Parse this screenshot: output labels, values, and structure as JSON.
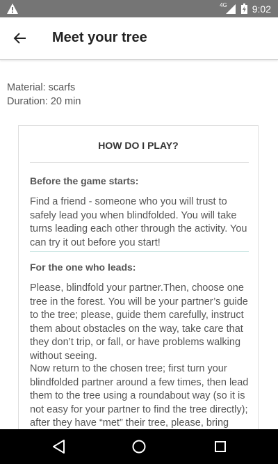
{
  "status_bar": {
    "network": "4G",
    "time": "9:02",
    "icons": [
      "warning-icon",
      "signal-icon",
      "battery-icon"
    ]
  },
  "app_bar": {
    "title": "Meet your tree",
    "back_icon": "arrow-left-icon"
  },
  "meta": {
    "material": "Material: scarfs",
    "duration": "Duration: 20 min"
  },
  "card": {
    "title": "HOW DO I PLAY?",
    "sections": [
      {
        "heading": "Before the game starts:",
        "paragraphs": [
          "Find a friend - someone who you will trust to safely lead you when blindfolded. You will take turns leading each other through the activity. You can try it out before you start!"
        ]
      },
      {
        "heading": "For the one who leads:",
        "paragraphs": [
          "Please, blindfold your partner.Then, choose one tree in the forest. You will be your partner’s guide to the tree; please, guide them carefully, instruct them about obstacles on the way, take care that they don’t trip, or fall, or have problems walking without seeing.",
          "Now return to the chosen tree; first turn your blindfolded partner around a few times, then lead them to the tree using a roundabout way (so it is not easy for your partner to find the tree directly); after they have “met” their tree, please, bring them back to the starting point. Once"
        ]
      }
    ]
  },
  "nav_bar": {
    "buttons": [
      "back-triangle-icon",
      "home-circle-icon",
      "recents-square-icon"
    ]
  },
  "colors": {
    "status_bar": "#757575",
    "text": "#555555",
    "title": "#222222",
    "divider_top": "#e0e0e0",
    "divider_accent": "#cfe8e6",
    "nav_bar": "#000000"
  }
}
